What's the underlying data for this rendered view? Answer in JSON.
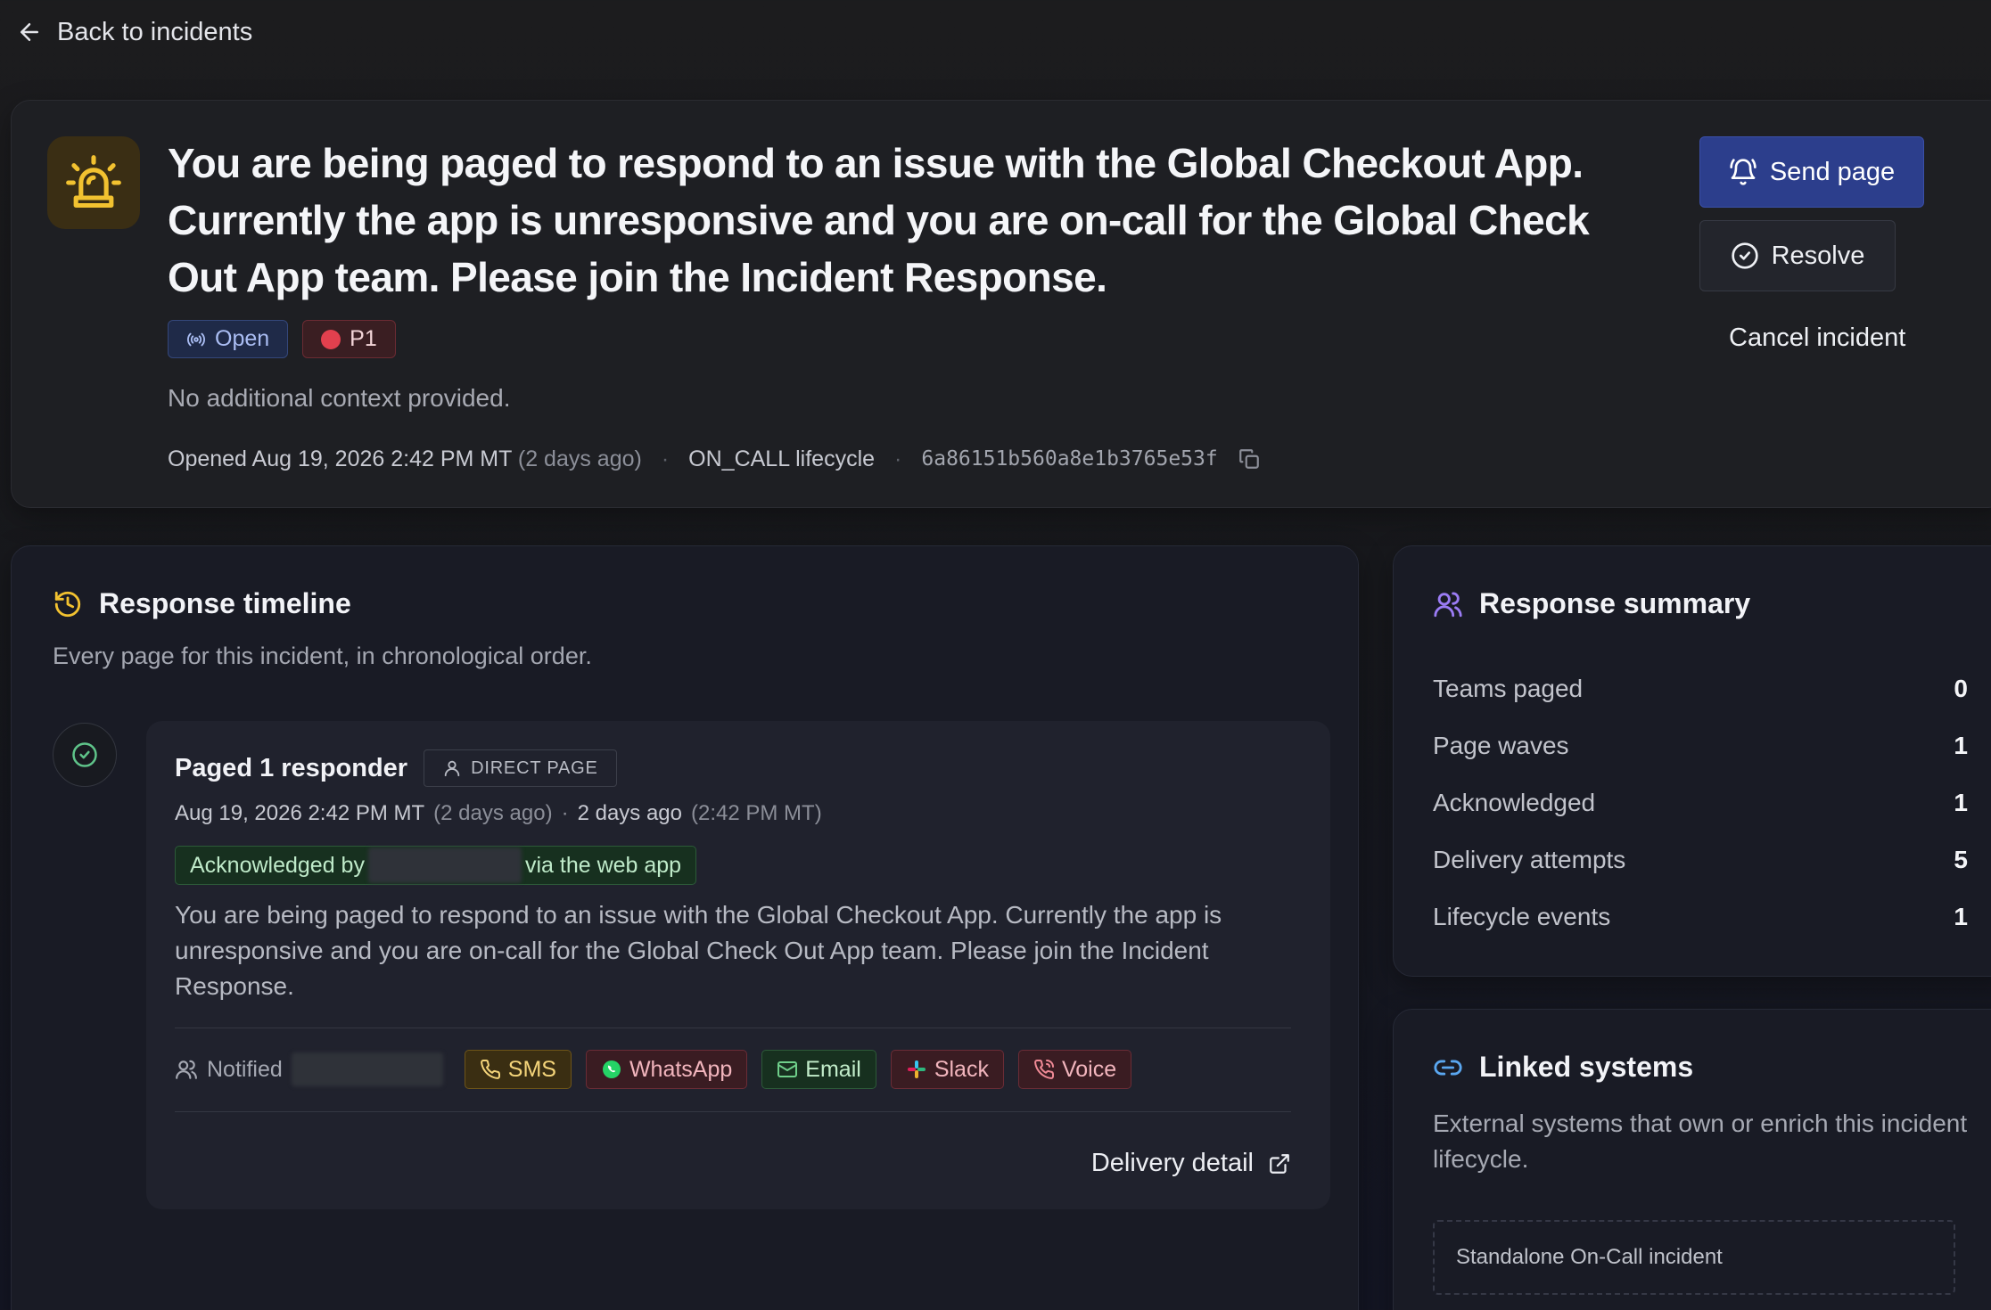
{
  "nav": {
    "back_label": "Back to incidents"
  },
  "incident": {
    "title": "You are being paged to respond to an issue with the Global Checkout App. Currently the app is unresponsive and you are on-call for the Global Check Out App team. Please join the Incident Response.",
    "status": "Open",
    "priority": "P1",
    "context": "No additional context provided.",
    "opened": "Opened Aug 19, 2026 2:42 PM MT",
    "opened_relative": "(2 days ago)",
    "lifecycle": "ON_CALL lifecycle",
    "id": "6a86151b560a8e1b3765e53f",
    "separator": "·"
  },
  "actions": {
    "send_page": "Send page",
    "resolve": "Resolve",
    "cancel": "Cancel incident"
  },
  "timeline": {
    "title": "Response timeline",
    "subtitle": "Every page for this incident, in chronological order.",
    "event": {
      "title": "Paged 1 responder",
      "tag": "DIRECT PAGE",
      "time": "Aug 19, 2026 2:42 PM MT",
      "time_relative": "(2 days ago)",
      "separator": "·",
      "ago": "2 days ago",
      "ago_detail": "(2:42 PM MT)",
      "ack_prefix": "Acknowledged by",
      "ack_suffix": "via the web app",
      "body": "You are being paged to respond to an issue with the Global Checkout App. Currently the app is unresponsive and you are on-call for the Global Check Out App team. Please join the Incident Response.",
      "notified_label": "Notified",
      "channels": {
        "sms": "SMS",
        "whatsapp": "WhatsApp",
        "email": "Email",
        "slack": "Slack",
        "voice": "Voice"
      },
      "delivery_detail": "Delivery detail"
    }
  },
  "summary": {
    "title": "Response summary",
    "stats": [
      {
        "label": "Teams paged",
        "value": "0"
      },
      {
        "label": "Page waves",
        "value": "1"
      },
      {
        "label": "Acknowledged",
        "value": "1"
      },
      {
        "label": "Delivery attempts",
        "value": "5"
      },
      {
        "label": "Lifecycle events",
        "value": "1"
      }
    ]
  },
  "linked": {
    "title": "Linked systems",
    "subtitle": "External systems that own or enrich this incident lifecycle.",
    "item": "Standalone On-Call incident"
  },
  "colors": {
    "primary_button": "#2c3e8c",
    "alert_accent": "#f2c230",
    "success": "#5fc48a",
    "danger": "#e2404e"
  },
  "icons": {
    "back": "arrow-left-icon",
    "alert": "siren-icon",
    "send": "bell-icon",
    "resolve": "check-circle-icon",
    "copy": "copy-icon",
    "timeline": "history-icon",
    "summary": "users-icon",
    "linked": "link-icon",
    "external": "external-link-icon"
  }
}
